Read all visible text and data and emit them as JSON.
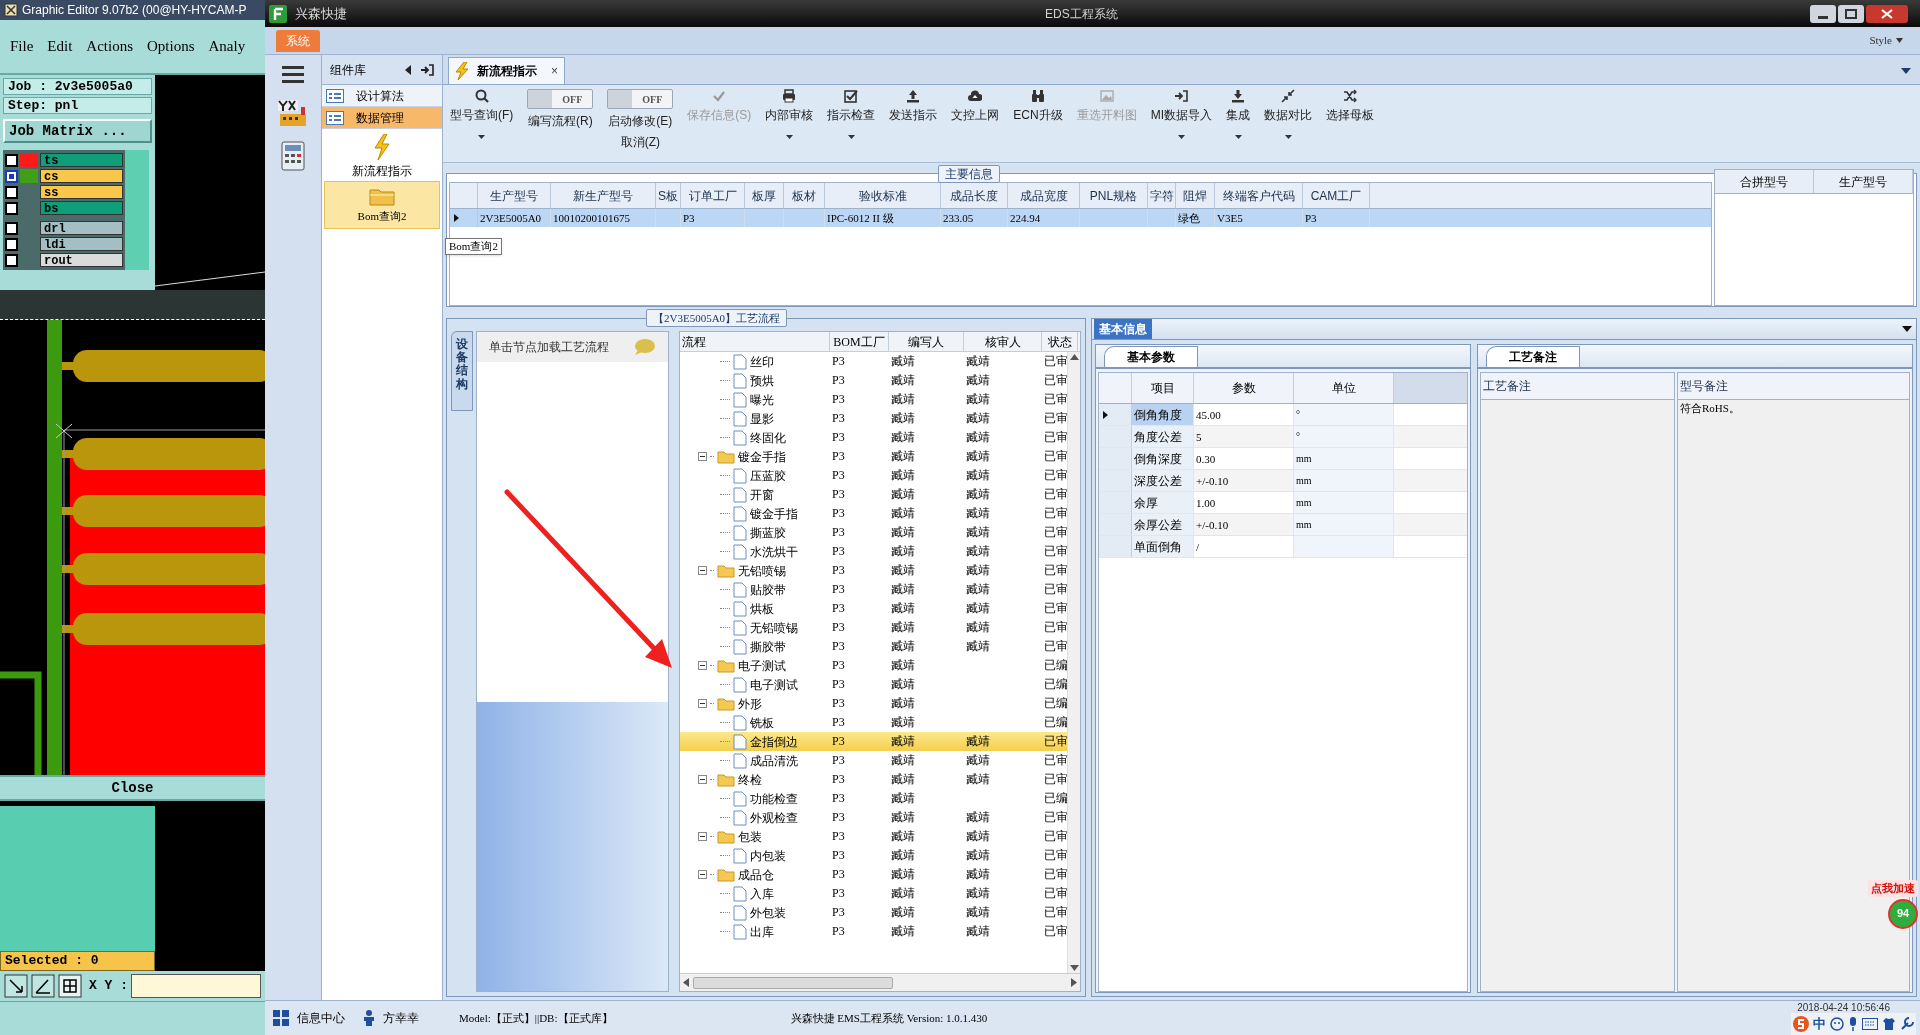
{
  "graphic_editor": {
    "title": "Graphic Editor 9.07b2 (00@HY-HYCAM-P",
    "menu": [
      "File",
      "Edit",
      "Actions",
      "Options",
      "Analy"
    ],
    "job": "Job : 2v3e5005a0",
    "step": "Step: pnl",
    "job_matrix_button": "Job Matrix ...",
    "layers": [
      {
        "name": "ts",
        "color": "#0f9e7a",
        "swatch": {
          "color": "#ff1a1a"
        },
        "selected": false
      },
      {
        "name": "cs",
        "color": "#f9c84a",
        "swatch": {
          "color": "#3fa017"
        },
        "selected": true
      },
      {
        "name": "ss",
        "color": "#f9c84a",
        "selected": false
      },
      {
        "name": "bs",
        "color": "#0f9e7a",
        "selected": false
      },
      {
        "name": "drl",
        "color": "#a3bfc4",
        "selected": false
      },
      {
        "name": "ldi",
        "color": "#a3bfc4",
        "selected": false
      },
      {
        "name": "rout",
        "color": "#d9dcdc",
        "selected": false
      }
    ],
    "close_button": "Close",
    "selected_count": "Selected : 0",
    "xy_label": "X Y :"
  },
  "eds": {
    "app_name": "兴森快捷",
    "title": "EDS工程系统",
    "ribbon_tab": "系统",
    "style_menu": "Style",
    "component_panel": {
      "title": "组件库",
      "items": [
        {
          "label": "设计算法",
          "selected": false
        },
        {
          "label": "数据管理",
          "selected": true
        }
      ],
      "modules": [
        {
          "label": "新流程指示",
          "kind": "flow",
          "selected": false
        },
        {
          "label": "Bom查询2",
          "kind": "folder",
          "selected": true
        }
      ]
    },
    "document_tab": {
      "label": "新流程指示",
      "close": "×"
    },
    "toolbar": [
      {
        "kind": "button",
        "label": "型号查询(F)",
        "disabled": false,
        "dropdown": true
      },
      {
        "kind": "toggle",
        "label": "编写流程(R)",
        "toggle_text": "OFF",
        "on": false
      },
      {
        "kind": "toggle",
        "label": "启动修改(E)",
        "sublabel": "取消(Z)",
        "toggle_text": "OFF",
        "on": false
      },
      {
        "kind": "button",
        "label": "保存信息(S)",
        "disabled": true,
        "dropdown": false
      },
      {
        "kind": "button",
        "label": "内部审核",
        "disabled": false,
        "dropdown": true
      },
      {
        "kind": "button",
        "label": "指示检查",
        "disabled": false,
        "dropdown": true
      },
      {
        "kind": "button",
        "label": "发送指示",
        "disabled": false,
        "dropdown": false
      },
      {
        "kind": "button",
        "label": "文控上网",
        "disabled": false,
        "dropdown": false
      },
      {
        "kind": "button",
        "label": "ECN升级",
        "disabled": false,
        "dropdown": false
      },
      {
        "kind": "button",
        "label": "重选开料图",
        "disabled": true,
        "dropdown": false
      },
      {
        "kind": "button",
        "label": "MI数据导入",
        "disabled": false,
        "dropdown": true
      },
      {
        "kind": "button",
        "label": "集成",
        "disabled": false,
        "dropdown": true
      },
      {
        "kind": "button",
        "label": "数据对比",
        "disabled": false,
        "dropdown": true
      },
      {
        "kind": "button",
        "label": "选择母板",
        "disabled": false,
        "dropdown": false
      }
    ],
    "main_info": {
      "title": "主要信息",
      "columns": [
        "生产型号",
        "新生产型号",
        "S板",
        "订单工厂",
        "板厚",
        "板材",
        "验收标准",
        "成品长度",
        "成品宽度",
        "PNL规格",
        "字符",
        "阻焊",
        "终端客户代码",
        "CAM工厂"
      ],
      "rows": [
        {
          "selected": true,
          "cells": [
            "2V3E5005A0",
            "10010200101675",
            null,
            "P3",
            null,
            null,
            "IPC-6012 II 级",
            "233.05",
            "224.94",
            null,
            null,
            "绿色",
            "V3E5",
            "P3"
          ]
        }
      ],
      "side_columns": [
        "合拼型号",
        "生产型号"
      ]
    },
    "tooltip": "Bom查询2",
    "process_flow": {
      "title": "【2V3E5005A0】工艺流程",
      "side_tab": "设备结构",
      "hint": "单击节点加载工艺流程",
      "columns": [
        "流程",
        "BOM工厂",
        "编写人",
        "核审人",
        "状态"
      ],
      "tree": [
        {
          "kind": "folder",
          "children": [
            {
              "kind": "step",
              "label": "丝印",
              "factory": "P3",
              "author": "臧靖",
              "reviewer": "臧靖",
              "status": "已审",
              "selected": false
            },
            {
              "kind": "step",
              "label": "预烘",
              "factory": "P3",
              "author": "臧靖",
              "reviewer": "臧靖",
              "status": "已审",
              "selected": false
            },
            {
              "kind": "step",
              "label": "曝光",
              "factory": "P3",
              "author": "臧靖",
              "reviewer": "臧靖",
              "status": "已审",
              "selected": false
            },
            {
              "kind": "step",
              "label": "显影",
              "factory": "P3",
              "author": "臧靖",
              "reviewer": "臧靖",
              "status": "已审",
              "selected": false
            },
            {
              "kind": "step",
              "label": "终固化",
              "factory": "P3",
              "author": "臧靖",
              "reviewer": "臧靖",
              "status": "已审",
              "selected": false
            }
          ]
        },
        {
          "kind": "folder",
          "label": "镀金手指",
          "factory": "P3",
          "author": "臧靖",
          "reviewer": "臧靖",
          "status": "已审",
          "selected": false,
          "expanded": true,
          "children": [
            {
              "kind": "step",
              "label": "压蓝胶",
              "factory": "P3",
              "author": "臧靖",
              "reviewer": "臧靖",
              "status": "已审",
              "selected": false
            },
            {
              "kind": "step",
              "label": "开窗",
              "factory": "P3",
              "author": "臧靖",
              "reviewer": "臧靖",
              "status": "已审",
              "selected": false
            },
            {
              "kind": "step",
              "label": "镀金手指",
              "factory": "P3",
              "author": "臧靖",
              "reviewer": "臧靖",
              "status": "已审",
              "selected": false
            },
            {
              "kind": "step",
              "label": "撕蓝胶",
              "factory": "P3",
              "author": "臧靖",
              "reviewer": "臧靖",
              "status": "已审",
              "selected": false
            },
            {
              "kind": "step",
              "label": "水洗烘干",
              "factory": "P3",
              "author": "臧靖",
              "reviewer": "臧靖",
              "status": "已审",
              "selected": false
            }
          ]
        },
        {
          "kind": "folder",
          "label": "无铅喷锡",
          "factory": "P3",
          "author": "臧靖",
          "reviewer": "臧靖",
          "status": "已审",
          "selected": false,
          "expanded": true,
          "children": [
            {
              "kind": "step",
              "label": "贴胶带",
              "factory": "P3",
              "author": "臧靖",
              "reviewer": "臧靖",
              "status": "已审",
              "selected": false
            },
            {
              "kind": "step",
              "label": "烘板",
              "factory": "P3",
              "author": "臧靖",
              "reviewer": "臧靖",
              "status": "已审",
              "selected": false
            },
            {
              "kind": "step",
              "label": "无铅喷锡",
              "factory": "P3",
              "author": "臧靖",
              "reviewer": "臧靖",
              "status": "已审",
              "selected": false
            },
            {
              "kind": "step",
              "label": "撕胶带",
              "factory": "P3",
              "author": "臧靖",
              "reviewer": "臧靖",
              "status": "已审",
              "selected": false
            }
          ]
        },
        {
          "kind": "folder",
          "label": "电子测试",
          "factory": "P3",
          "author": "臧靖",
          "status": "已编",
          "selected": false,
          "expanded": true,
          "children": [
            {
              "kind": "step",
              "label": "电子测试",
              "factory": "P3",
              "author": "臧靖",
              "status": "已编",
              "selected": false
            }
          ]
        },
        {
          "kind": "folder",
          "label": "外形",
          "factory": "P3",
          "author": "臧靖",
          "status": "已编",
          "selected": false,
          "expanded": true,
          "children": [
            {
              "kind": "step",
              "label": "铣板",
              "factory": "P3",
              "author": "臧靖",
              "status": "已编",
              "selected": false
            },
            {
              "kind": "step",
              "label": "金指倒边",
              "factory": "P3",
              "author": "臧靖",
              "reviewer": "臧靖",
              "status": "已审",
              "selected": true
            },
            {
              "kind": "step",
              "label": "成品清洗",
              "factory": "P3",
              "author": "臧靖",
              "reviewer": "臧靖",
              "status": "已审",
              "selected": false
            }
          ]
        },
        {
          "kind": "folder",
          "label": "终检",
          "factory": "P3",
          "author": "臧靖",
          "reviewer": "臧靖",
          "status": "已审",
          "selected": false,
          "expanded": true,
          "children": [
            {
              "kind": "step",
              "label": "功能检查",
              "factory": "P3",
              "author": "臧靖",
              "status": "已编",
              "selected": false
            },
            {
              "kind": "step",
              "label": "外观检查",
              "factory": "P3",
              "author": "臧靖",
              "reviewer": "臧靖",
              "status": "已审",
              "selected": false
            }
          ]
        },
        {
          "kind": "folder",
          "label": "包装",
          "factory": "P3",
          "author": "臧靖",
          "reviewer": "臧靖",
          "status": "已审",
          "selected": false,
          "expanded": true,
          "children": [
            {
              "kind": "step",
              "label": "内包装",
              "factory": "P3",
              "author": "臧靖",
              "reviewer": "臧靖",
              "status": "已审",
              "selected": false
            }
          ]
        },
        {
          "kind": "folder",
          "label": "成品仓",
          "factory": "P3",
          "author": "臧靖",
          "reviewer": "臧靖",
          "status": "已审",
          "selected": false,
          "expanded": true,
          "children": [
            {
              "kind": "step",
              "label": "入库",
              "factory": "P3",
              "author": "臧靖",
              "reviewer": "臧靖",
              "status": "已审",
              "selected": false
            },
            {
              "kind": "step",
              "label": "外包装",
              "factory": "P3",
              "author": "臧靖",
              "reviewer": "臧靖",
              "status": "已审",
              "selected": false
            },
            {
              "kind": "step",
              "label": "出库",
              "factory": "P3",
              "author": "臧靖",
              "reviewer": "臧靖",
              "status": "已审",
              "selected": false
            }
          ]
        }
      ]
    },
    "basic_info": {
      "title": "基本信息",
      "params": {
        "tab": "基本参数",
        "columns": [
          "项目",
          "参数",
          "单位"
        ],
        "rows": [
          {
            "item": "倒角角度",
            "value": "45.00",
            "unit": "°",
            "selected": true
          },
          {
            "item": "角度公差",
            "value": "5",
            "unit": "°",
            "selected": false
          },
          {
            "item": "倒角深度",
            "value": "0.30",
            "unit": "mm",
            "selected": false
          },
          {
            "item": "深度公差",
            "value": "+/-0.10",
            "unit": "mm",
            "selected": false
          },
          {
            "item": "余厚",
            "value": "1.00",
            "unit": "mm",
            "selected": false
          },
          {
            "item": "余厚公差",
            "value": "+/-0.10",
            "unit": "mm",
            "selected": false
          },
          {
            "item": "单面倒角",
            "value": "/",
            "selected": false
          }
        ]
      },
      "notes": {
        "tab": "工艺备注",
        "columns": [
          "工艺备注",
          "型号备注"
        ],
        "model_note": "符合RoHS。"
      }
    },
    "status_bar": {
      "info_center": "信息中心",
      "user": "方幸幸",
      "db": "Model:【正式】||DB:【正式库】",
      "version": "兴森快捷 EMS工程系统 Version: 1.0.1.430"
    }
  },
  "tray": {
    "ime": "中",
    "clock": "2018-04-24 10:56:46"
  },
  "speed_widget": {
    "label": "点我加速",
    "value": "94"
  }
}
